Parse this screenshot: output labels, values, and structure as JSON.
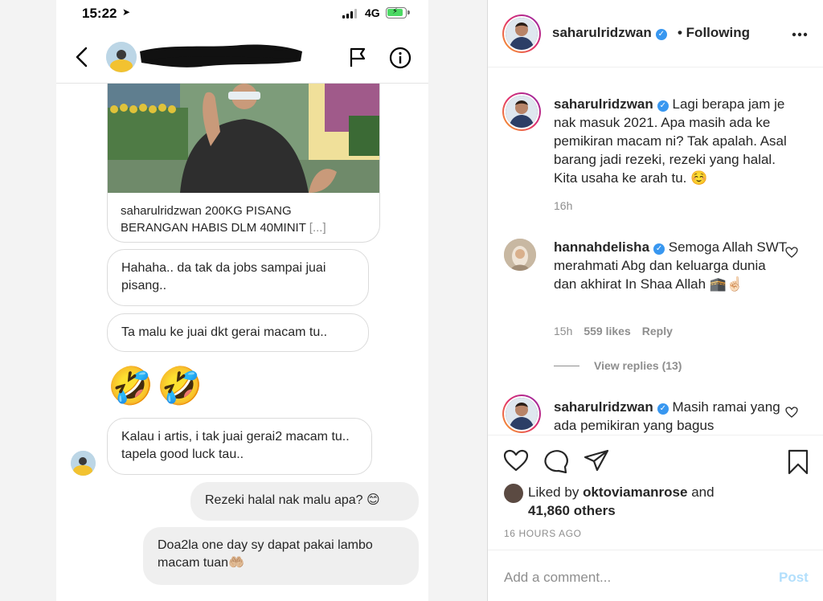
{
  "status_bar": {
    "time": "15:22",
    "network": "4G"
  },
  "dm": {
    "shared_post_caption_user": "saharulridzwan",
    "shared_post_caption_text": " 200KG PISANG BERANGAN HABIS DLM 40MINIT ",
    "shared_post_ellipsis": "[...]",
    "messages": [
      {
        "text": "Hahaha.. da tak da jobs sampai juai pisang.."
      },
      {
        "text": "Ta malu ke juai dkt gerai macam tu.."
      },
      {
        "text": "🤣🤣"
      },
      {
        "text": "Kalau i artis, i tak juai gerai2 macam tu.. tapela good luck tau.."
      },
      {
        "text": "Rezeki halal nak malu apa? 😊"
      },
      {
        "text": "Doa2la one day sy dapat pakai lambo macam tuan🤲🏼"
      }
    ]
  },
  "post": {
    "header_username": "saharulridzwan",
    "following_label": "• Following",
    "caption": {
      "username": "saharulridzwan",
      "text": "Lagi berapa jam je nak masuk 2021. Apa masih ada ke pemikiran macam ni? Tak apalah. Asal barang jadi rezeki, rezeki yang halal. Kita usaha ke arah tu. ☺️",
      "time": "16h"
    },
    "comments": [
      {
        "username": "hannahdelisha",
        "text": "Semoga Allah SWT merahmati Abg dan keluarga dunia dan akhirat In Shaa Allah 🕋☝🏻",
        "time": "15h",
        "likes": "559 likes",
        "reply_label": "Reply",
        "view_replies": "View replies (13)"
      },
      {
        "username": "saharulridzwan",
        "text": "Masih ramai yang ada pemikiran yang bagus"
      }
    ],
    "liked_by_prefix": "Liked by",
    "liked_by_user": "oktoviamanrose",
    "liked_by_and": "and",
    "liked_by_others": "41,860 others",
    "timestamp": "16 HOURS AGO",
    "add_comment_placeholder": "Add a comment...",
    "post_button": "Post"
  },
  "colors": {
    "verified": "#3897f0",
    "post_button_disabled": "#b2dffc",
    "battery": "#4cd964"
  }
}
